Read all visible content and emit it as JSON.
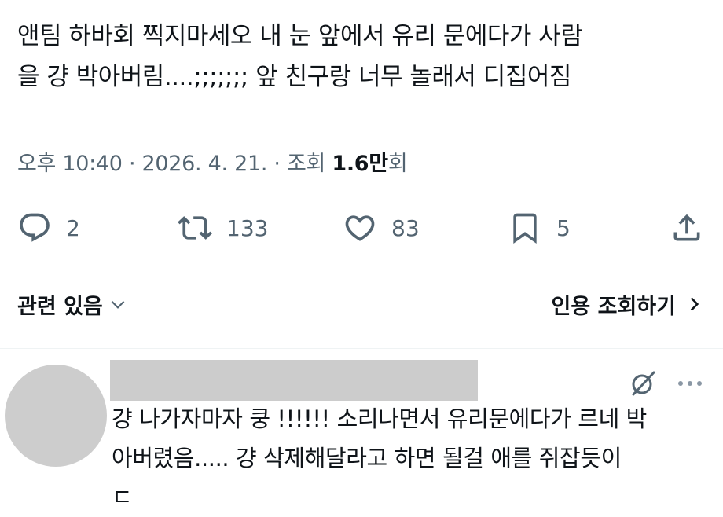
{
  "tweet": {
    "text_line1": "앤팀 하바회 찍지마세오 내 눈 앞에서 유리 문에다가 사람",
    "text_line2": "을 걍 박아버림....;;;;;;; 앞 친구랑 너무 놀래서 디집어짐"
  },
  "meta": {
    "time": "오후 10:40",
    "separator": " · ",
    "date": "2026. 4. 21.",
    "views_label": "조회 ",
    "views_count": "1.6만",
    "views_suffix": "회"
  },
  "actions": {
    "reply_count": "2",
    "repost_count": "133",
    "like_count": "83",
    "bookmark_count": "5"
  },
  "related": {
    "left_label": "관련 있음",
    "right_label": "인용 조회하기"
  },
  "reply": {
    "text_line1": "걍 나가자마자 쿵 !!!!!! 소리나면서 유리문에다가 르네 박",
    "text_line2": "아버렸음..... 걍 삭제해달라고 하면 될걸 애를 쥐잡듯이",
    "text_line3": "ㄷ"
  },
  "icons": {
    "reply": "speech-bubble-icon",
    "repost": "repost-arrows-icon",
    "like": "heart-icon",
    "bookmark": "bookmark-icon",
    "share": "share-upload-icon",
    "chevron_down": "chevron-down-icon",
    "chevron_right": "chevron-right-icon",
    "grok": "slashed-circle-icon",
    "more": "more-dots-icon"
  },
  "colors": {
    "text": "#0f1419",
    "secondary": "#536471",
    "divider": "#eff3f4",
    "redaction": "#cccccc"
  }
}
